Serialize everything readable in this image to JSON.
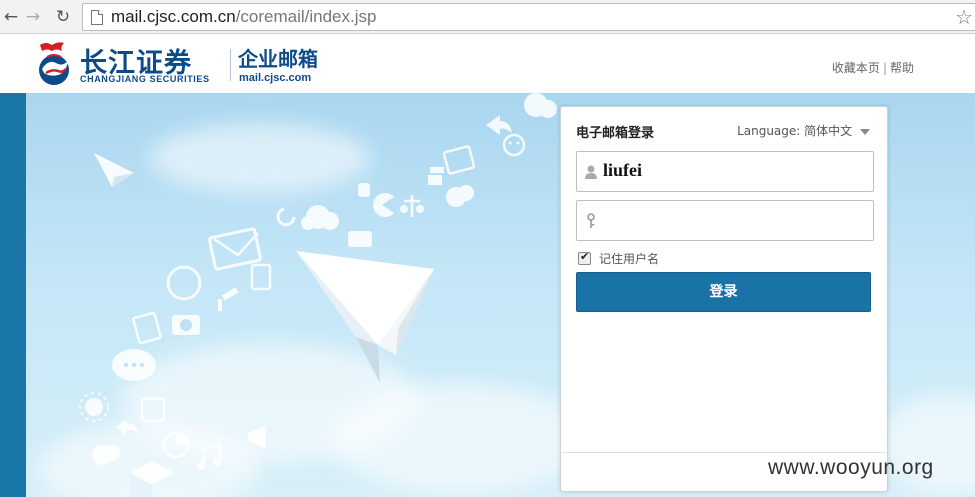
{
  "browser": {
    "url_host": "mail.cjsc.com.cn",
    "url_path": "/coremail/index.jsp"
  },
  "header": {
    "brand_cn": "长江证券",
    "brand_en": "CHANGJIANG SECURITIES",
    "product": "企业邮箱",
    "product_domain": "mail.cjsc.com",
    "links": [
      "收藏本页",
      "帮助"
    ],
    "link_separator": "|"
  },
  "login": {
    "title": "电子邮箱登录",
    "language_label": "Language:",
    "language_value": "简体中文",
    "username_value": "liufei",
    "password_value": "",
    "remember_label": "记住用户名",
    "remember_checked": true,
    "submit_label": "登录"
  },
  "watermark": "www.wooyun.org",
  "colors": {
    "brand_blue": "#0d4a8a",
    "button_blue": "#1a73a7",
    "left_bar": "#1b76a8",
    "logo_red": "#d21f26"
  },
  "icons": {
    "nav": [
      "back-arrow-icon",
      "forward-arrow-icon",
      "reload-icon"
    ],
    "page": "page-icon",
    "bookmark": "star-icon",
    "username": "user-icon",
    "password": "key-icon"
  }
}
